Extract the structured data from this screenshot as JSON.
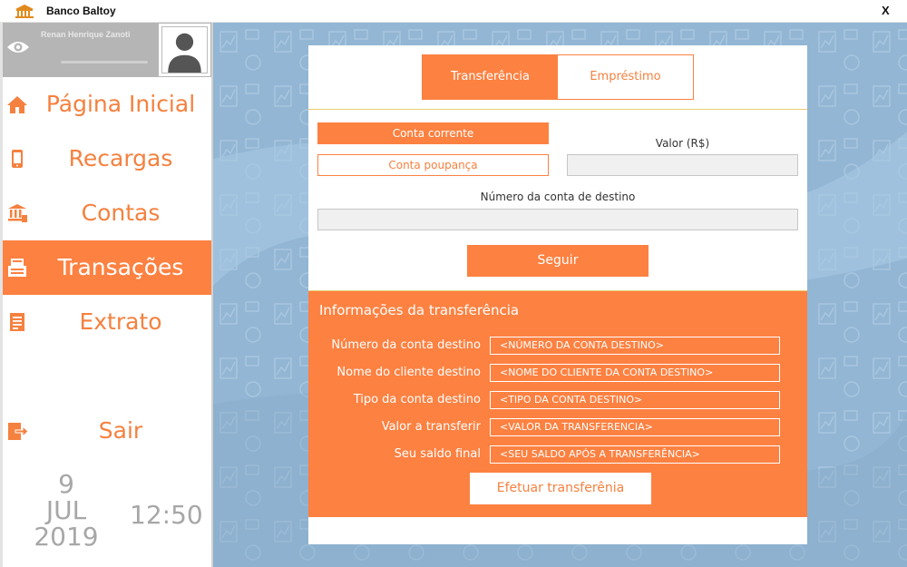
{
  "window": {
    "title": "Banco Baltoy",
    "close_label": "X"
  },
  "user": {
    "name": "Renan Henrique Zanoti"
  },
  "sidebar": {
    "items": [
      {
        "label": "Página Inicial",
        "icon": "home-icon"
      },
      {
        "label": "Recargas",
        "icon": "phone-icon"
      },
      {
        "label": "Contas",
        "icon": "bank-icon"
      },
      {
        "label": "Transações",
        "icon": "atm-icon",
        "active": true
      },
      {
        "label": "Extrato",
        "icon": "statement-icon"
      },
      {
        "label": "Sair",
        "icon": "logout-icon"
      }
    ]
  },
  "clock": {
    "day": "9",
    "month": "JUL",
    "year": "2019",
    "time": "12:50"
  },
  "tabs": {
    "transfer": "Transferência",
    "loan": "Empréstimo"
  },
  "form": {
    "account_checking": "Conta corrente",
    "account_savings": "Conta poupança",
    "amount_label": "Valor (R$)",
    "amount_value": "",
    "dest_account_label": "Número da conta de destino",
    "dest_account_value": "",
    "next_button": "Seguir"
  },
  "info": {
    "title": "Informações da transferência",
    "rows": [
      {
        "label": "Número da conta destino",
        "value": "<NÚMERO DA CONTA DESTINO>"
      },
      {
        "label": "Nome do cliente destino",
        "value": "<NOME DO CLIENTE DA CONTA DESTINO>"
      },
      {
        "label": "Tipo da conta destino",
        "value": "<TIPO DA CONTA DESTINO>"
      },
      {
        "label": "Valor a transferir",
        "value": "<VALOR DA TRANSFERENCIA>"
      },
      {
        "label": "Seu saldo final",
        "value": "<SEU SALDO APÓS A TRANSFERÊNCIA>"
      }
    ],
    "submit_button": "Efetuar transferênia"
  },
  "colors": {
    "accent": "#fd8141",
    "background": "#92b6d4",
    "gold_divider": "#e8cc72"
  }
}
